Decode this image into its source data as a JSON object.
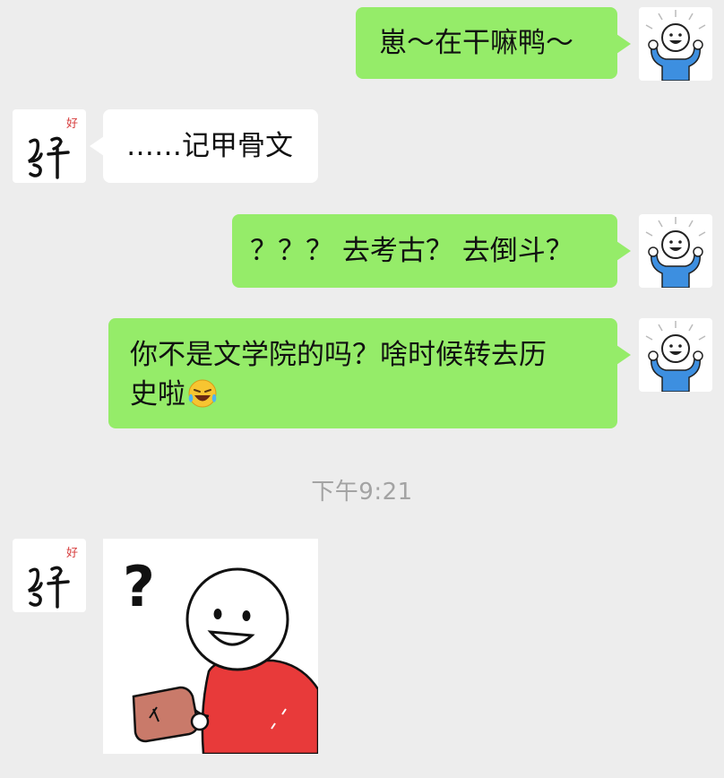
{
  "messages": [
    {
      "side": "right",
      "text": "崽～在干嘛鸭～"
    },
    {
      "side": "left",
      "text": "……记甲骨文"
    },
    {
      "side": "right",
      "text": "？？？ 去考古？ 去倒斗？"
    },
    {
      "side": "right",
      "text_line1": "你不是文学院的吗？啥时候转去历",
      "text_line2": "史啦",
      "emoji": "laughing-crying-emoji"
    },
    {
      "side": "left",
      "type": "sticker",
      "sticker_text": "?"
    }
  ],
  "timestamp": "下午9:21",
  "contact_avatar": {
    "label": "好",
    "glyph": "oracle-bone-good-character"
  },
  "self_avatar": {
    "icon": "cheering-stick-figure"
  },
  "colors": {
    "background": "#ededed",
    "self_bubble": "#95ec69",
    "other_bubble": "#ffffff",
    "self_avatar_shirt": "#3d8fe0",
    "sticker_shirt": "#e83a3a",
    "contact_label": "#d63b3b"
  }
}
